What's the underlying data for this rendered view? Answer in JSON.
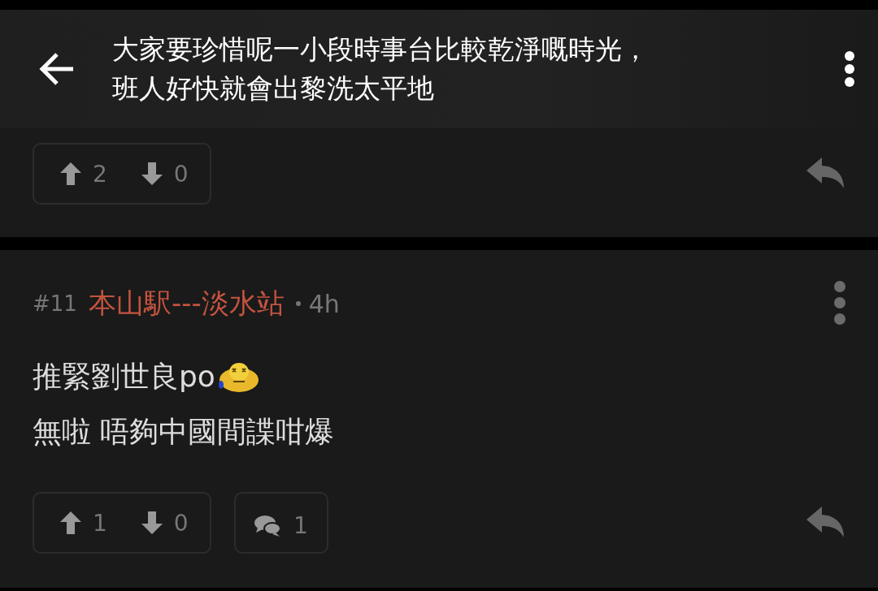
{
  "header": {
    "title_lines": [
      "大家要珍惜呢一小段時事台比較乾淨嘅時光，",
      "班人好快就會出黎洗太平地"
    ]
  },
  "posts": [
    {
      "kind": "partial",
      "upvotes": "2",
      "downvotes": "0"
    },
    {
      "kind": "full",
      "number": "#11",
      "author": "本山駅---淡水站",
      "time": "4h",
      "lines": [
        "推緊劉世良po",
        "無啦 唔夠中國間諜咁爆"
      ],
      "upvotes": "1",
      "downvotes": "0",
      "replies": "1"
    }
  ]
}
